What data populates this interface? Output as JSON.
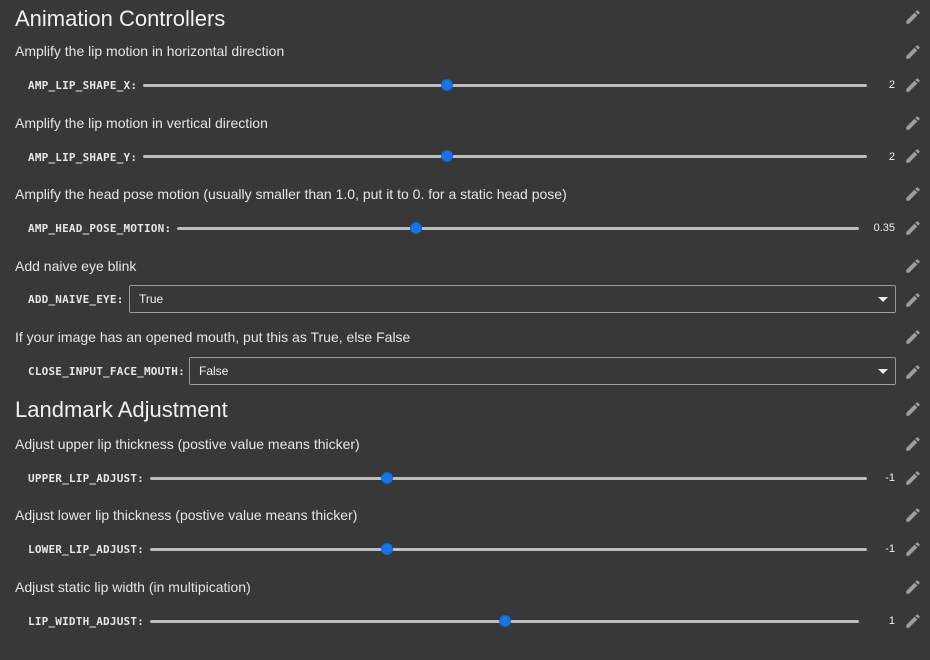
{
  "sections": {
    "animation_title": "Animation Controllers",
    "landmark_title": "Landmark Adjustment"
  },
  "params": {
    "amp_lip_shape_x": {
      "desc": "Amplify the lip motion in horizontal direction",
      "label": "AMP_LIP_SHAPE_X:",
      "value": "2"
    },
    "amp_lip_shape_y": {
      "desc": "Amplify the lip motion in vertical direction",
      "label": "AMP_LIP_SHAPE_Y:",
      "value": "2"
    },
    "amp_head_pose_motion": {
      "desc": "Amplify the head pose motion (usually smaller than 1.0, put it to 0. for a static head pose)",
      "label": "AMP_HEAD_POSE_MOTION:",
      "value": "0.35"
    },
    "add_naive_eye": {
      "desc": "Add naive eye blink",
      "label": "ADD_NAIVE_EYE:",
      "value": "True"
    },
    "close_input_face_mouth": {
      "desc": "If your image has an opened mouth, put this as True, else False",
      "label": "CLOSE_INPUT_FACE_MOUTH:",
      "value": "False"
    },
    "upper_lip_adjust": {
      "desc": "Adjust upper lip thickness (postive value means thicker)",
      "label": "UPPER_LIP_ADJUST:",
      "value": "-1"
    },
    "lower_lip_adjust": {
      "desc": "Adjust lower lip thickness (postive value means thicker)",
      "label": "LOWER_LIP_ADJUST:",
      "value": "-1"
    },
    "lip_width_adjust": {
      "desc": "Adjust static lip width (in multipication)",
      "label": "LIP_WIDTH_ADJUST:",
      "value": "1"
    }
  },
  "sliders": {
    "amp_lip_shape_x": 0.42,
    "amp_lip_shape_y": 0.42,
    "amp_head_pose_motion": 0.35,
    "upper_lip_adjust": 0.33,
    "lower_lip_adjust": 0.33,
    "lip_width_adjust": 0.5
  },
  "icons": {
    "edit": "pencil-icon",
    "dropdown": "caret-down-icon"
  },
  "colors": {
    "accent": "#1a73e8",
    "background": "#383838",
    "track": "#bdbdbd"
  }
}
